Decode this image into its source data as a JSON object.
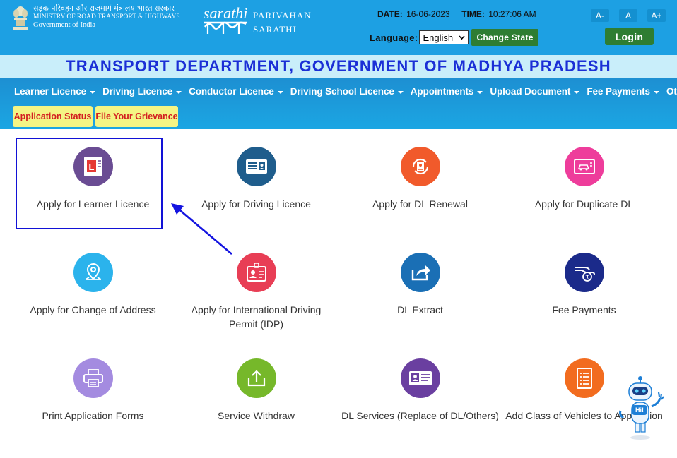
{
  "header": {
    "ministry_hindi": "सड़क परिवहन और राजमार्ग मंत्रालय भारत सरकार",
    "ministry_english": "MINISTRY OF ROAD TRANSPORT & HIGHWAYS",
    "government": "Government of India",
    "logo_text": "sarathi",
    "brand_line1": "PARIVAHAN",
    "brand_line2": "SARATHI",
    "date_label": "DATE:",
    "date_value": "16-06-2023",
    "time_label": "TIME:",
    "time_value": "10:27:06 AM",
    "language_label": "Language:",
    "language_selected": "English",
    "change_state_label": "Change State",
    "font_decrease": "A-",
    "font_normal": "A",
    "font_increase": "A+",
    "login_label": "Login"
  },
  "title": "TRANSPORT DEPARTMENT, GOVERNMENT OF MADHYA PRADESH",
  "nav": {
    "items": [
      {
        "label": "Learner Licence"
      },
      {
        "label": "Driving Licence"
      },
      {
        "label": "Conductor Licence"
      },
      {
        "label": "Driving School Licence"
      },
      {
        "label": "Appointments"
      },
      {
        "label": "Upload Document"
      },
      {
        "label": "Fee Payments"
      },
      {
        "label": "Others"
      }
    ],
    "application_status": "Application Status",
    "grievance": "File Your Grievance"
  },
  "tiles": [
    {
      "label": "Apply for Learner Licence",
      "color": "#6a4c93",
      "icon": "learner-licence-icon"
    },
    {
      "label": "Apply for Driving Licence",
      "color": "#1f5d8c",
      "icon": "driving-licence-icon"
    },
    {
      "label": "Apply for DL Renewal",
      "color": "#f15a2b",
      "icon": "dl-renewal-icon"
    },
    {
      "label": "Apply for Duplicate DL",
      "color": "#ee3d9b",
      "icon": "duplicate-dl-icon"
    },
    {
      "label": "Apply for Change of Address",
      "color": "#2bb3ec",
      "icon": "map-pin-icon"
    },
    {
      "label": "Apply for International Driving Permit (IDP)",
      "color": "#e83e55",
      "icon": "idp-icon"
    },
    {
      "label": "DL Extract",
      "color": "#1a6fb5",
      "icon": "share-icon"
    },
    {
      "label": "Fee Payments",
      "color": "#1b2a8a",
      "icon": "fee-payment-icon"
    },
    {
      "label": "Print Application Forms",
      "color": "#a48be0",
      "icon": "printer-icon"
    },
    {
      "label": "Service Withdraw",
      "color": "#76b82a",
      "icon": "upload-tray-icon"
    },
    {
      "label": "DL Services (Replace of DL/Others)",
      "color": "#6a3fa0",
      "icon": "id-card-icon"
    },
    {
      "label": "Add Class of Vehicles to Application",
      "color": "#f26c1f",
      "icon": "form-list-icon"
    }
  ],
  "chatbot": {
    "bubble": "Hi!"
  }
}
